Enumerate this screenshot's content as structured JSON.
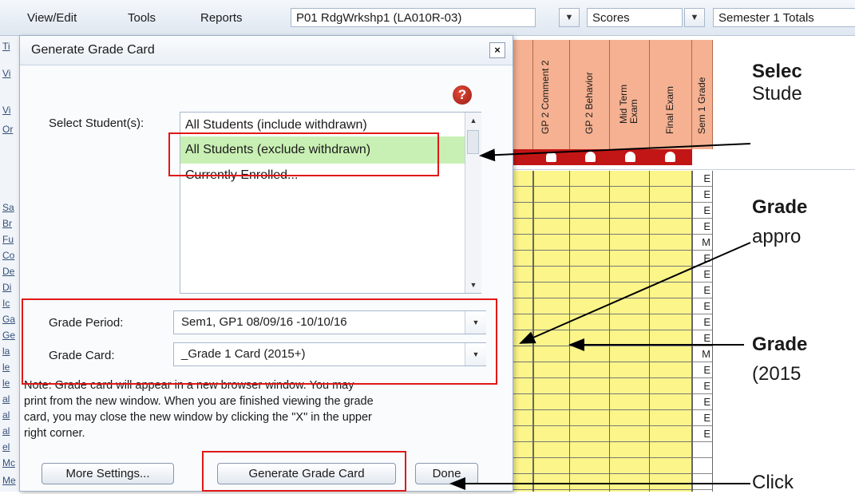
{
  "toolbar": {
    "menu": [
      "View/Edit",
      "Tools",
      "Reports"
    ],
    "class_select": "P01  RdgWrkshp1 (LA010R-03)",
    "view_select": "Scores",
    "totals_select": "Semester 1 Totals"
  },
  "grid": {
    "column_headers": [
      "GP 2 Comment 2",
      "GP 2 Behavior",
      "Mid Term Exam",
      "Final Exam",
      "Sem 1 Grade"
    ],
    "sem1_grades": [
      "E",
      "E",
      "E",
      "E",
      "M",
      "E",
      "E",
      "E",
      "E",
      "E",
      "E",
      "M",
      "E",
      "E",
      "E",
      "E",
      "E"
    ],
    "cell_color": "#fbf58a",
    "header_color": "#f5b191"
  },
  "dialog": {
    "title": "Generate Grade Card",
    "close": "×",
    "help": "?",
    "select_students_label": "Select Student(s):",
    "students_options": [
      "All Students (include withdrawn)",
      "All Students (exclude withdrawn)",
      "Currently Enrolled..."
    ],
    "students_selected": "All Students (exclude withdrawn)",
    "grade_period_label": "Grade Period:",
    "grade_period_value": "Sem1, GP1  08/09/16  -10/10/16",
    "grade_card_label": "Grade Card:",
    "grade_card_value": "_Grade 1 Card (2015+)",
    "note": "Note: Grade card will appear in a new browser window. You may print from the new window. When you are finished viewing the grade card, you may close the new window by clicking the \"X\" in the upper right corner.",
    "buttons": {
      "more_settings": "More Settings...",
      "generate": "Generate Grade Card",
      "done": "Done"
    }
  },
  "callouts": {
    "c1_bold": "Selec",
    "c1_text": "Stude",
    "c2_bold": "Grade",
    "c2_text": "appro",
    "c3_bold": "Grade",
    "c3_text": "(2015",
    "c4_text": "Click"
  },
  "accent": {
    "highlight_red": "#e01818",
    "selection_green": "#c9f0b4"
  }
}
